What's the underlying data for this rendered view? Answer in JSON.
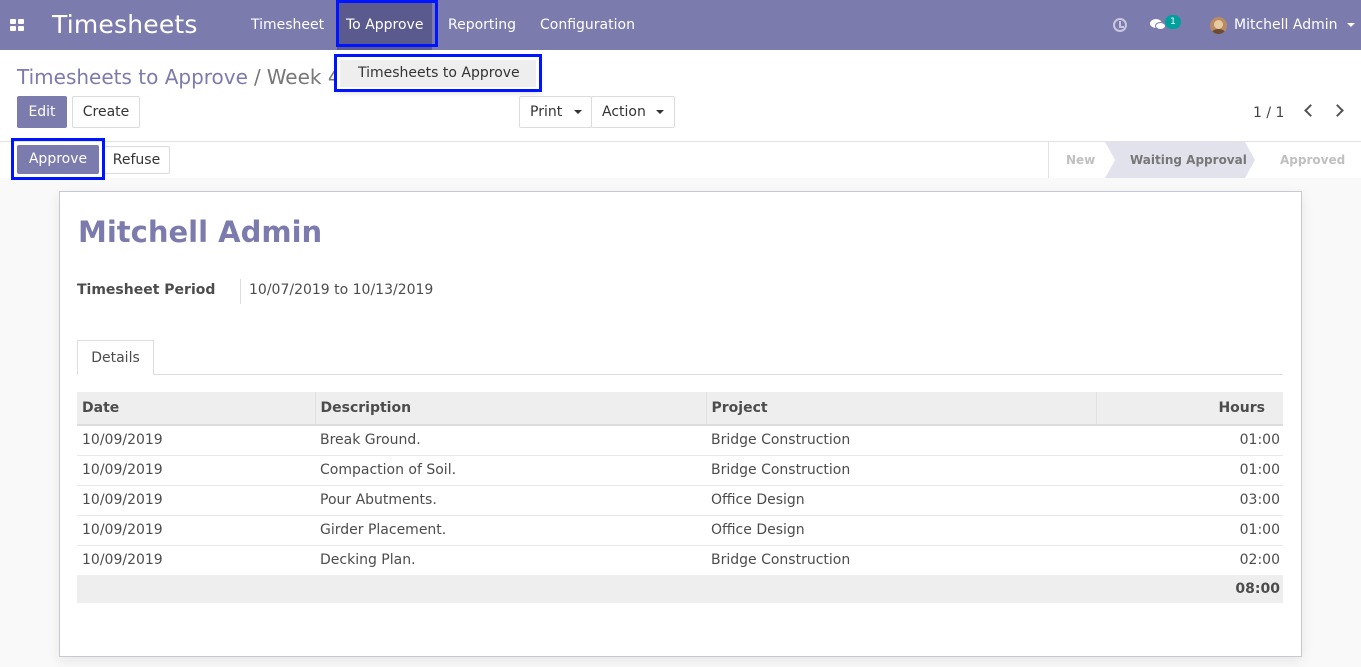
{
  "navbar": {
    "brand": "Timesheets",
    "menu": [
      "Timesheet",
      "To Approve",
      "Reporting",
      "Configuration"
    ],
    "notification_count": "1",
    "user_name": "Mitchell Admin"
  },
  "dropdown": {
    "item": "Timesheets to Approve"
  },
  "breadcrumb": {
    "parent": "Timesheets to Approve",
    "separator": "/",
    "current": "Week 4"
  },
  "toolbar": {
    "edit": "Edit",
    "create": "Create",
    "print": "Print",
    "action": "Action",
    "pager": "1 / 1"
  },
  "status_bar": {
    "approve": "Approve",
    "refuse": "Refuse",
    "stages": [
      "New",
      "Waiting Approval",
      "Approved"
    ]
  },
  "sheet": {
    "employee": "Mitchell Admin",
    "period_label": "Timesheet Period",
    "period_value": "10/07/2019 to 10/13/2019",
    "tab": "Details"
  },
  "table": {
    "headers": [
      "Date",
      "Description",
      "Project",
      "Hours"
    ],
    "rows": [
      [
        "10/09/2019",
        "Break Ground.",
        "Bridge Construction",
        "01:00"
      ],
      [
        "10/09/2019",
        "Compaction of Soil.",
        "Bridge Construction",
        "01:00"
      ],
      [
        "10/09/2019",
        "Pour Abutments.",
        "Office Design",
        "03:00"
      ],
      [
        "10/09/2019",
        "Girder Placement.",
        "Office Design",
        "01:00"
      ],
      [
        "10/09/2019",
        "Decking Plan.",
        "Bridge Construction",
        "02:00"
      ]
    ],
    "total": "08:00"
  },
  "colors": {
    "brand": "#7c7bad",
    "highlight": "#0015ff",
    "badge": "#00a09d"
  },
  "icons": [
    "apps-icon",
    "clock-icon",
    "chat-icon",
    "avatar",
    "caret-down-icon",
    "chevron-left-icon",
    "chevron-right-icon"
  ]
}
